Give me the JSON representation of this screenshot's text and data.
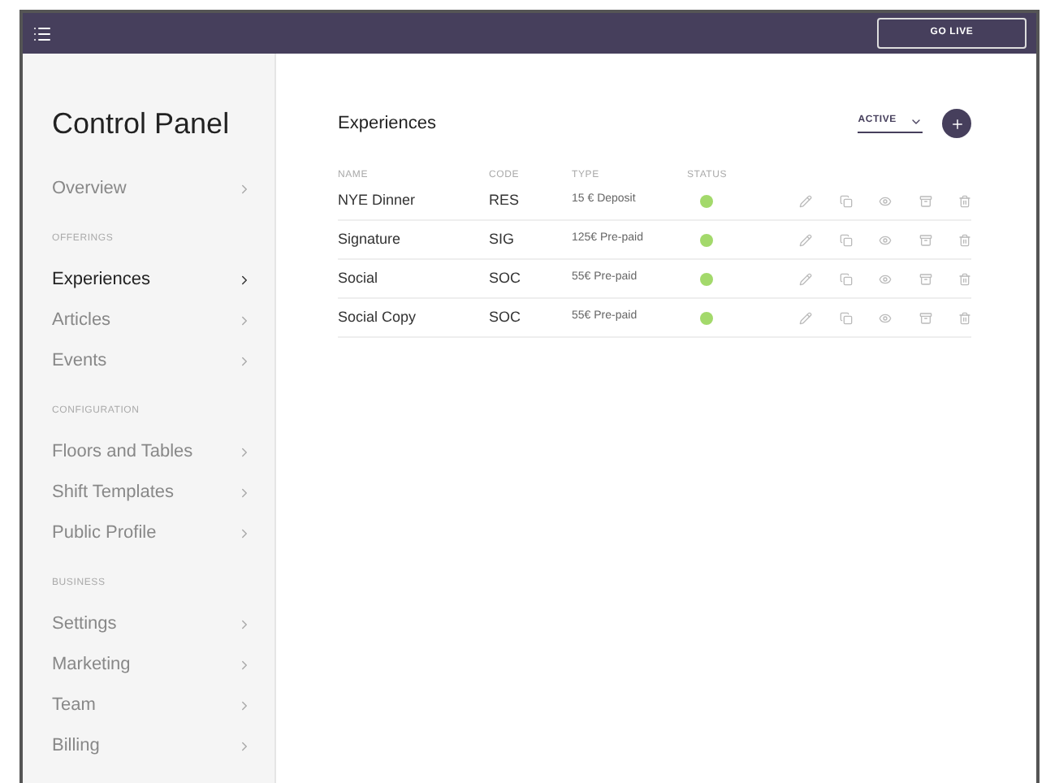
{
  "top_bar": {
    "go_live_button": "GO LIVE"
  },
  "sidebar": {
    "title": "Control Panel",
    "sections": [
      {
        "items": [
          {
            "label": "Overview",
            "selected": false
          }
        ]
      },
      {
        "heading": "OFFERINGS",
        "items": [
          {
            "label": "Experiences",
            "selected": true
          },
          {
            "label": "Articles",
            "selected": false
          },
          {
            "label": "Events",
            "selected": false
          }
        ]
      },
      {
        "heading": "CONFIGURATION",
        "items": [
          {
            "label": "Floors and Tables",
            "selected": false
          },
          {
            "label": "Shift Templates",
            "selected": false
          },
          {
            "label": "Public Profile",
            "selected": false
          }
        ]
      },
      {
        "heading": "BUSINESS",
        "items": [
          {
            "label": "Settings",
            "selected": false
          },
          {
            "label": "Marketing",
            "selected": false
          },
          {
            "label": "Team",
            "selected": false
          },
          {
            "label": "Billing",
            "selected": false
          }
        ]
      }
    ]
  },
  "main": {
    "title": "Experiences",
    "filter": "ACTIVE",
    "table": {
      "columns": [
        "NAME",
        "CODE",
        "TYPE",
        "STATUS"
      ],
      "rows": [
        {
          "name": "NYE Dinner",
          "code": "RES",
          "type": "15 € Deposit",
          "color": "#a3d96b"
        },
        {
          "name": "Signature",
          "code": "SIG",
          "type": "125€ Pre-paid",
          "color": "#a3d96b"
        },
        {
          "name": "Social",
          "code": "SOC",
          "type": "55€ Pre-paid",
          "color": "#a3d96b"
        },
        {
          "name": "Social Copy",
          "code": "SOC",
          "type": "55€ Pre-paid",
          "color": "#a3d96b"
        }
      ]
    }
  }
}
